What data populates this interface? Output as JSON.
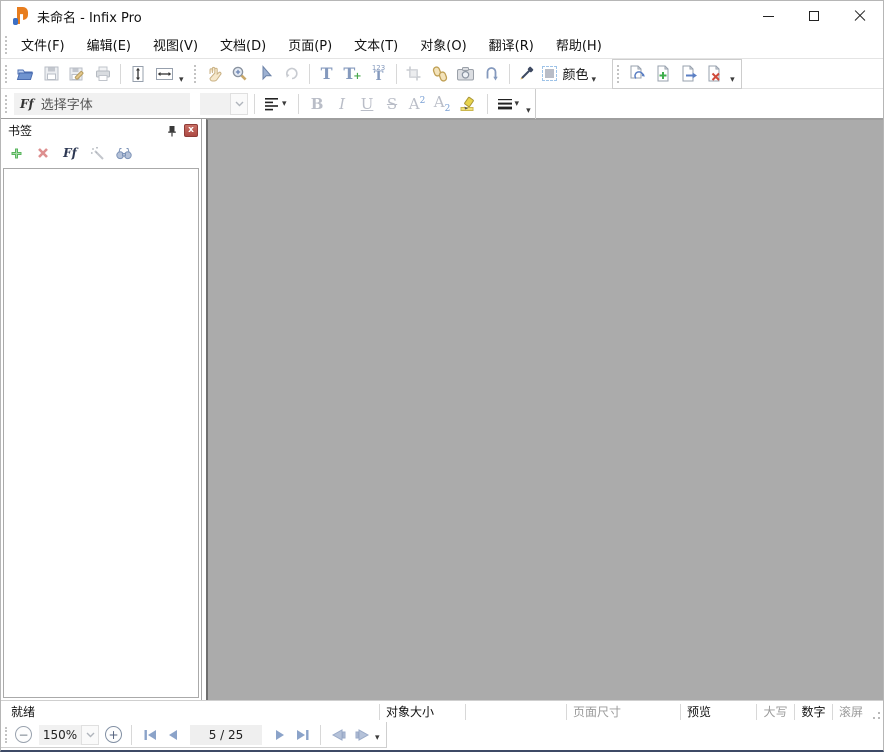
{
  "window": {
    "title": "未命名 - Infix Pro"
  },
  "menu": {
    "items": [
      "文件(F)",
      "编辑(E)",
      "视图(V)",
      "文档(D)",
      "页面(P)",
      "文本(T)",
      "对象(O)",
      "翻译(R)",
      "帮助(H)"
    ]
  },
  "toolbar_main": {
    "color_button_label": "颜色"
  },
  "toolbar_text": {
    "font_icon": "Ff",
    "font_placeholder": "选择字体",
    "bold": "B",
    "italic": "I",
    "underline": "U",
    "strikethrough": "S",
    "superscript": {
      "base": "A",
      "mark": "2"
    },
    "subscript": {
      "base": "A",
      "mark": "2"
    },
    "text_tool": "T",
    "text_plus_tool": "T",
    "text_num_tool": "T",
    "text_num_marks": "123"
  },
  "bookmarks_panel": {
    "title": "书签",
    "font_button": "Ff",
    "close": "x"
  },
  "statusbar": {
    "ready": "就绪",
    "object_size": "对象大小",
    "page_size": "页面尺寸",
    "preview": "预览",
    "caps": "大写",
    "num": "数字",
    "scroll": "滚屏"
  },
  "navbar": {
    "zoom_level": "150%",
    "page_indicator": "5 / 25",
    "zoom_out": "−",
    "zoom_in": "+"
  },
  "colors": {
    "document_bg": "#ababab",
    "nav_arrow_blue": "#8ba3c9",
    "nav_arrow_light": "#b5c2d9",
    "panel_close_red": "#ad4a44",
    "add_green": "#58b55c",
    "delete_red": "#d04a3a",
    "accent_orange": "#e87d1e"
  }
}
